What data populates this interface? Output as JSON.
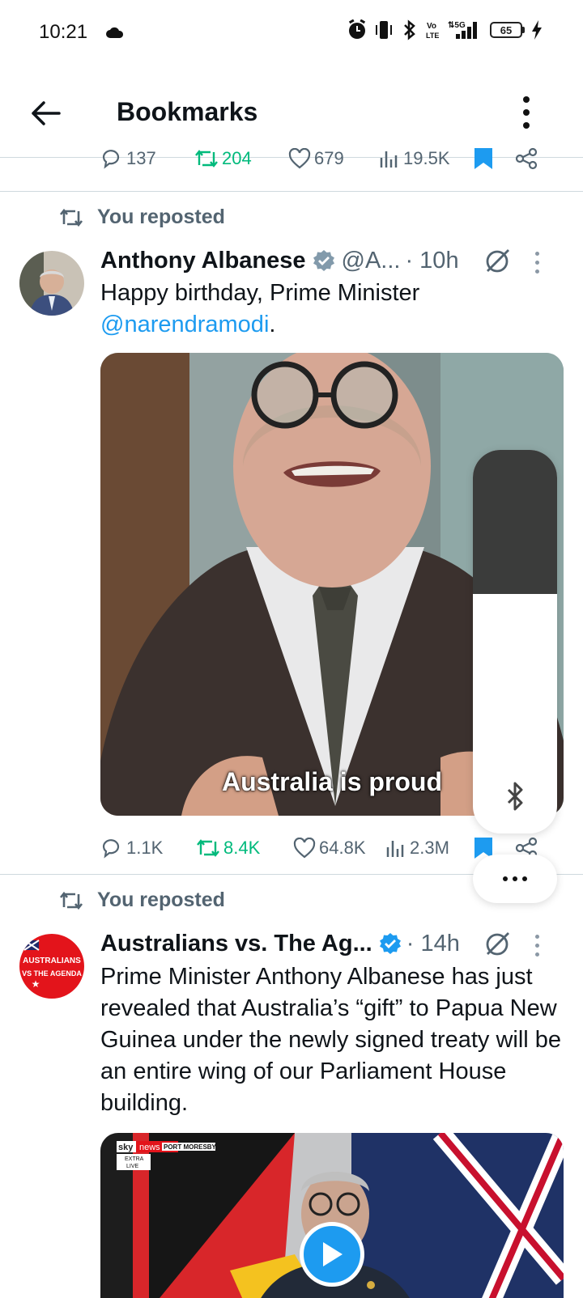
{
  "status_bar": {
    "time": "10:21",
    "battery": "65",
    "network": "5G"
  },
  "header": {
    "title": "Bookmarks"
  },
  "previous_tweet": {
    "replies": "137",
    "reposts": "204",
    "likes": "679",
    "views": "19.5K",
    "bookmarked": true
  },
  "tweets": [
    {
      "repost_label": "You reposted",
      "name": "Anthony Albanese",
      "handle": "@A...",
      "time": "· 10h",
      "text": "Happy birthday, Prime Minister",
      "mention": "@narendramodi",
      "text_suffix": ".",
      "video_caption": "Australia is proud",
      "replies": "1.1K",
      "reposts": "8.4K",
      "likes": "64.8K",
      "views": "2.3M"
    },
    {
      "repost_label": "You reposted",
      "name": "Australians vs. The Ag...",
      "time": "· 14h",
      "text": "Prime Minister Anthony Albanese has just revealed that Australia’s “gift” to Papua New Guinea under the newly signed treaty will be an entire wing of our Parliament House building.",
      "avatar_text_1": "AUSTRALIANS",
      "avatar_text_2": "VS THE AGENDA",
      "media_logo": "sky",
      "media_logo_2": "news",
      "media_location": "PORT MORESBY",
      "media_tag_1": "EXTRA",
      "media_tag_2": "LIVE"
    }
  ],
  "colors": {
    "accent": "#1d9bf0",
    "repost_green": "#00ba7c",
    "secondary_text": "#536471"
  }
}
